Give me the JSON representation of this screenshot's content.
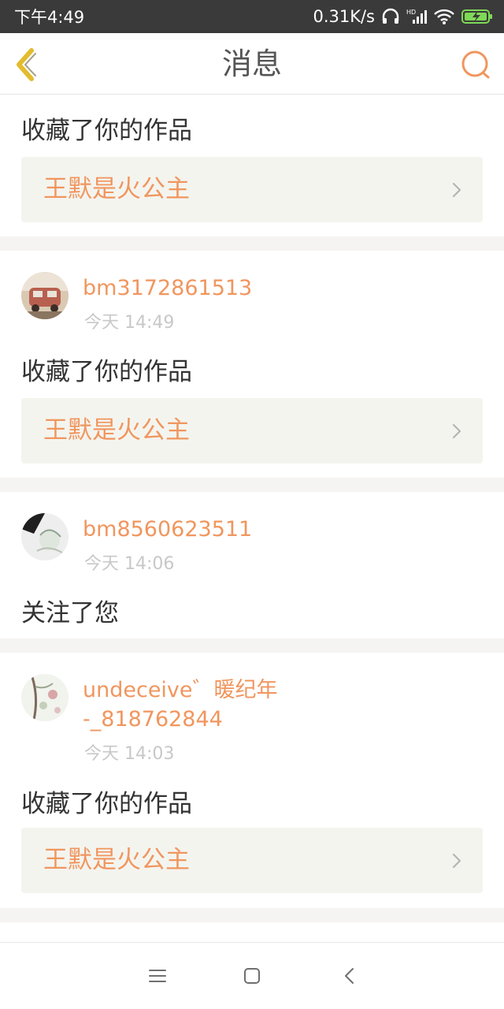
{
  "status_bar": {
    "time": "下午4:49",
    "network_speed": "0.31K/s",
    "icons": [
      "headphones-icon",
      "hd-signal-icon",
      "wifi-icon",
      "battery-charging-icon"
    ]
  },
  "header": {
    "title": "消息",
    "back_icon": "chevron-left-icon",
    "search_icon": "search-icon"
  },
  "colors": {
    "accent": "#f0965e",
    "back_icon": "#e3bc2e",
    "link_bg": "#f4f4ef",
    "divider": "#f6f4f2",
    "status_bar": "#3a3a3a"
  },
  "messages": [
    {
      "action": "收藏了你的作品",
      "work_title": "王默是火公主"
    },
    {
      "username": "bm3172861513",
      "time": "今天 14:49",
      "action": "收藏了你的作品",
      "work_title": "王默是火公主"
    },
    {
      "username": "bm8560623511",
      "time": "今天 14:06",
      "action": "关注了您"
    },
    {
      "username_line1": "undeceive゛暖纪年",
      "username_line2": "-_818762844",
      "time": "今天 14:03",
      "action": "收藏了你的作品",
      "work_title": "王默是火公主"
    }
  ],
  "nav_bar": {
    "icons": [
      "menu-icon",
      "home-icon",
      "back-icon"
    ]
  }
}
